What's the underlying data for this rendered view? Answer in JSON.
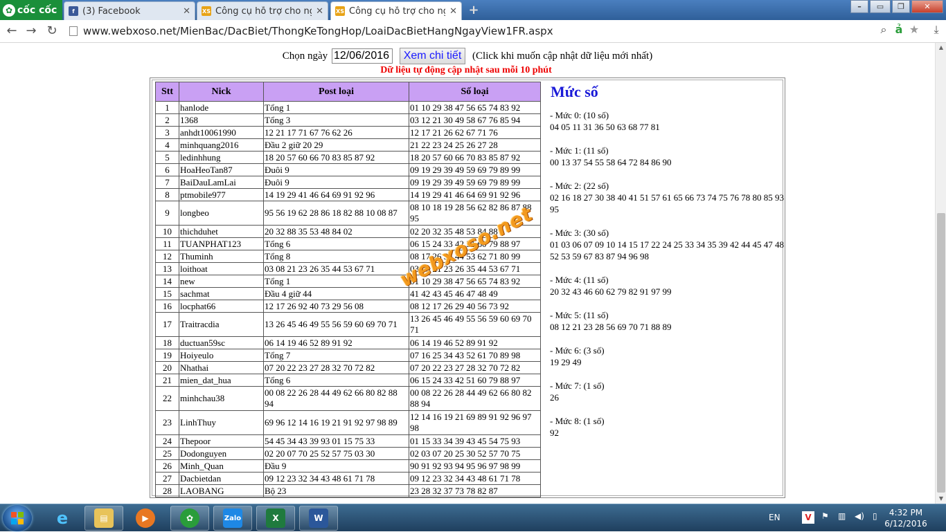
{
  "browser": {
    "brand": "cốc cốc",
    "tabs": [
      {
        "title": "(3) Facebook",
        "favicon": "f",
        "favicon_color": "#3b5998"
      },
      {
        "title": "Công cụ hỗ trợ cho người",
        "favicon": "XS",
        "favicon_color": "#e8a317"
      },
      {
        "title": "Công cụ hỗ trợ cho người",
        "favicon": "XS",
        "favicon_color": "#e8a317"
      }
    ],
    "url": "www.webxoso.net/MienBac/DacBiet/ThongKeTongHop/LoaiDacBietHangNgayView1FR.aspx"
  },
  "controls": {
    "date_label": "Chọn ngày",
    "date_value": "12/06/2016",
    "view_button": "Xem chi tiết",
    "hint": "(Click khi muốn cập nhật dữ liệu mới nhất)",
    "auto_note": "Dữ liệu tự động cập nhật sau mỗi 10 phút"
  },
  "table": {
    "headers": [
      "Stt",
      "Nick",
      "Post loại",
      "Số loại"
    ],
    "rows": [
      {
        "stt": "1",
        "nick": "hanlode",
        "post": "Tổng 1",
        "so": "01 10 29 38 47 56 65 74 83 92"
      },
      {
        "stt": "2",
        "nick": "1368",
        "post": "Tổng 3",
        "so": "03 12 21 30 49 58 67 76 85 94"
      },
      {
        "stt": "3",
        "nick": "anhdt10061990",
        "post": "12 21 17 71 67 76 62 26",
        "so": "12 17 21 26 62 67 71 76"
      },
      {
        "stt": "4",
        "nick": "minhquang2016",
        "post": "Đầu 2 giữ 20 29",
        "so": "21 22 23 24 25 26 27 28"
      },
      {
        "stt": "5",
        "nick": "ledinhhung",
        "post": "18 20 57 60 66 70 83 85 87 92",
        "so": "18 20 57 60 66 70 83 85 87 92"
      },
      {
        "stt": "6",
        "nick": "HoaHeoTan87",
        "post": "Đuôi 9",
        "so": "09 19 29 39 49 59 69 79 89 99"
      },
      {
        "stt": "7",
        "nick": "BaiDauLamLai",
        "post": "Đuôi 9",
        "so": "09 19 29 39 49 59 69 79 89 99"
      },
      {
        "stt": "8",
        "nick": "ptmobile977",
        "post": "14 19 29 41 46 64 69 91 92 96",
        "so": "14 19 29 41 46 64 69 91 92 96"
      },
      {
        "stt": "9",
        "nick": "longbeo",
        "post": "95 56 19 62 28 86 18 82 88 10 08 87",
        "so": "08 10 18 19 28 56 62 82 86 87 88 95"
      },
      {
        "stt": "10",
        "nick": "thichduhet",
        "post": "20 32 88 35 53 48 84 02",
        "so": "02 20 32 35 48 53 84 88"
      },
      {
        "stt": "11",
        "nick": "TUANPHAT123",
        "post": "Tổng 6",
        "so": "06 15 24 33 42 51 60 79 88 97"
      },
      {
        "stt": "12",
        "nick": "Thuminh",
        "post": "Tổng 8",
        "so": "08 17 26 35 44 53 62 71 80 99"
      },
      {
        "stt": "13",
        "nick": "loithoat",
        "post": "03 08 21 23 26 35 44 53 67 71",
        "so": "03 08 21 23 26 35 44 53 67 71"
      },
      {
        "stt": "14",
        "nick": "new",
        "post": "Tổng 1",
        "so": "01 10 29 38 47 56 65 74 83 92"
      },
      {
        "stt": "15",
        "nick": "sachmat",
        "post": "Đầu 4 giữ 44",
        "so": "41 42 43 45 46 47 48 49"
      },
      {
        "stt": "16",
        "nick": "locphat66",
        "post": "12 17 26 92 40 73 29 56 08",
        "so": "08 12 17 26 29 40 56 73 92"
      },
      {
        "stt": "17",
        "nick": "Traitracdia",
        "post": "13 26 45 46 49 55 56 59 60 69 70 71",
        "so": "13 26 45 46 49 55 56 59 60 69 70 71"
      },
      {
        "stt": "18",
        "nick": "ductuan59sc",
        "post": "06 14 19 46 52 89 91 92",
        "so": "06 14 19 46 52 89 91 92"
      },
      {
        "stt": "19",
        "nick": "Hoiyeulo",
        "post": "Tổng 7",
        "so": "07 16 25 34 43 52 61 70 89 98"
      },
      {
        "stt": "20",
        "nick": "Nhathai",
        "post": "07 20 22 23 27 28 32 70 72 82",
        "so": "07 20 22 23 27 28 32 70 72 82"
      },
      {
        "stt": "21",
        "nick": "mien_dat_hua",
        "post": "Tổng 6",
        "so": "06 15 24 33 42 51 60 79 88 97"
      },
      {
        "stt": "22",
        "nick": "minhchau38",
        "post": "00 08 22 26 28 44 49 62 66 80 82 88 94",
        "so": "00 08 22 26 28 44 49 62 66 80 82 88 94"
      },
      {
        "stt": "23",
        "nick": "LinhThuy",
        "post": "69 96 12 14 16 19 21 91 92 97 98 89",
        "so": "12 14 16 19 21 69 89 91 92 96 97 98"
      },
      {
        "stt": "24",
        "nick": "Thepoor",
        "post": "54 45 34 43 39 93 01 15 75 33",
        "so": "01 15 33 34 39 43 45 54 75 93"
      },
      {
        "stt": "25",
        "nick": "Dodonguyen",
        "post": "02 20 07 70 25 52 57 75 03 30",
        "so": "02 03 07 20 25 30 52 57 70 75"
      },
      {
        "stt": "26",
        "nick": "Minh_Quan",
        "post": "Đầu 9",
        "so": "90 91 92 93 94 95 96 97 98 99"
      },
      {
        "stt": "27",
        "nick": "Dacbietdan",
        "post": "09 12 23 32 34 43 48 61 71 78",
        "so": "09 12 23 32 34 43 48 61 71 78"
      },
      {
        "stt": "28",
        "nick": "LAOBANG",
        "post": "Bộ 23",
        "so": "23 28 32 37 73 78 82 87"
      }
    ]
  },
  "levels": {
    "title": "Mức số",
    "items": [
      {
        "label": "- Mức 0: (10 số)",
        "numbers": "04 05 11 31 36 50 63 68 77 81"
      },
      {
        "label": "- Mức 1: (11 số)",
        "numbers": "00 13 37 54 55 58 64 72 84 86 90"
      },
      {
        "label": "- Mức 2: (22 số)",
        "numbers": "02 16 18 27 30 38 40 41 51 57 61 65 66 73 74 75 76 78 80 85 93 95"
      },
      {
        "label": "- Mức 3: (30 số)",
        "numbers": "01 03 06 07 09 10 14 15 17 22 24 25 33 34 35 39 42 44 45 47 48 52 53 59 67 83 87 94 96 98"
      },
      {
        "label": "- Mức 4: (11 số)",
        "numbers": "20 32 43 46 60 62 79 82 91 97 99"
      },
      {
        "label": "- Mức 5: (11 số)",
        "numbers": "08 12 21 23 28 56 69 70 71 88 89"
      },
      {
        "label": "- Mức 6: (3 số)",
        "numbers": "19 29 49"
      },
      {
        "label": "- Mức 7: (1 số)",
        "numbers": "26"
      },
      {
        "label": "- Mức 8: (1 số)",
        "numbers": "92"
      }
    ]
  },
  "watermark": "webxoso.net",
  "taskbar": {
    "items": [
      "Zalo"
    ],
    "lang": "EN",
    "time": "4:32 PM",
    "date": "6/12/2016"
  },
  "colors": {
    "header_bg": "#c9a0f4",
    "note_red": "#e00000",
    "title_blue": "#1a1ad8",
    "watermark": "#f39a1e"
  }
}
